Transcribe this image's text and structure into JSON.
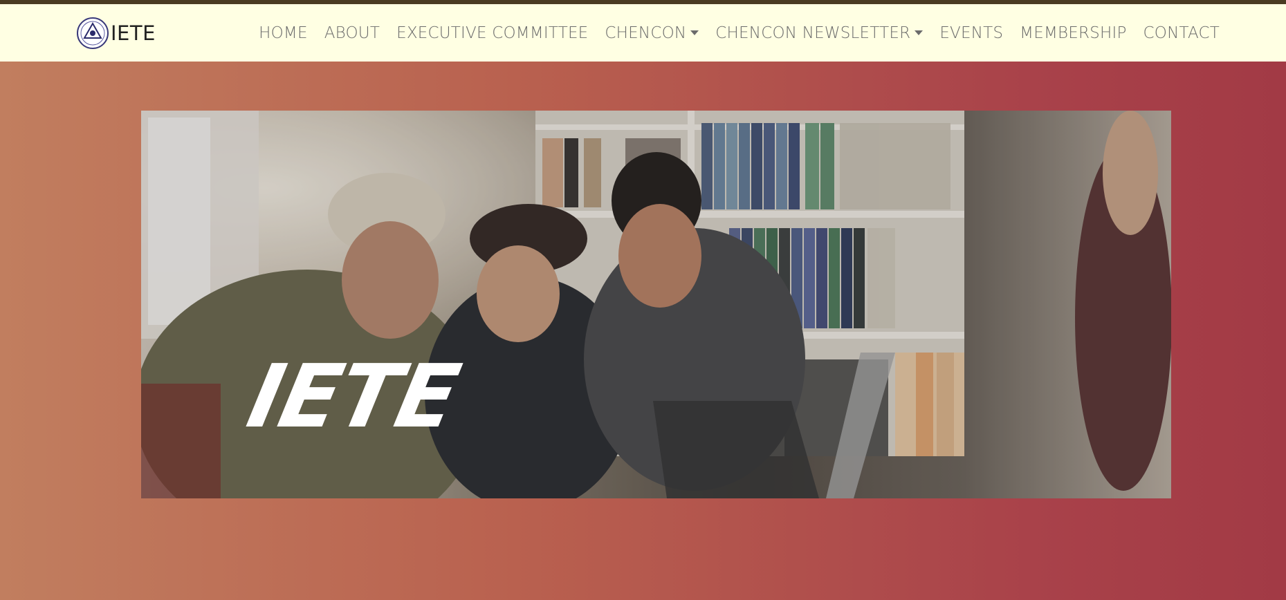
{
  "brand": {
    "name": "IETE"
  },
  "nav": {
    "items": [
      {
        "label": "HOME",
        "dropdown": false
      },
      {
        "label": "ABOUT",
        "dropdown": false
      },
      {
        "label": "EXECUTIVE COMMITTEE",
        "dropdown": false
      },
      {
        "label": "CHENCON",
        "dropdown": true
      },
      {
        "label": "CHENCON NEWSLETTER",
        "dropdown": true
      },
      {
        "label": "EVENTS",
        "dropdown": false
      },
      {
        "label": "MEMBERSHIP",
        "dropdown": false
      },
      {
        "label": "CONTACT",
        "dropdown": false
      }
    ]
  },
  "hero": {
    "title": "IETE"
  },
  "colors": {
    "navbar_bg": "#ffffe3",
    "top_strip": "#4a3b22",
    "gradient_start": "#c17e5f",
    "gradient_end": "#a23a45",
    "nav_text": "#6b6b6b"
  }
}
